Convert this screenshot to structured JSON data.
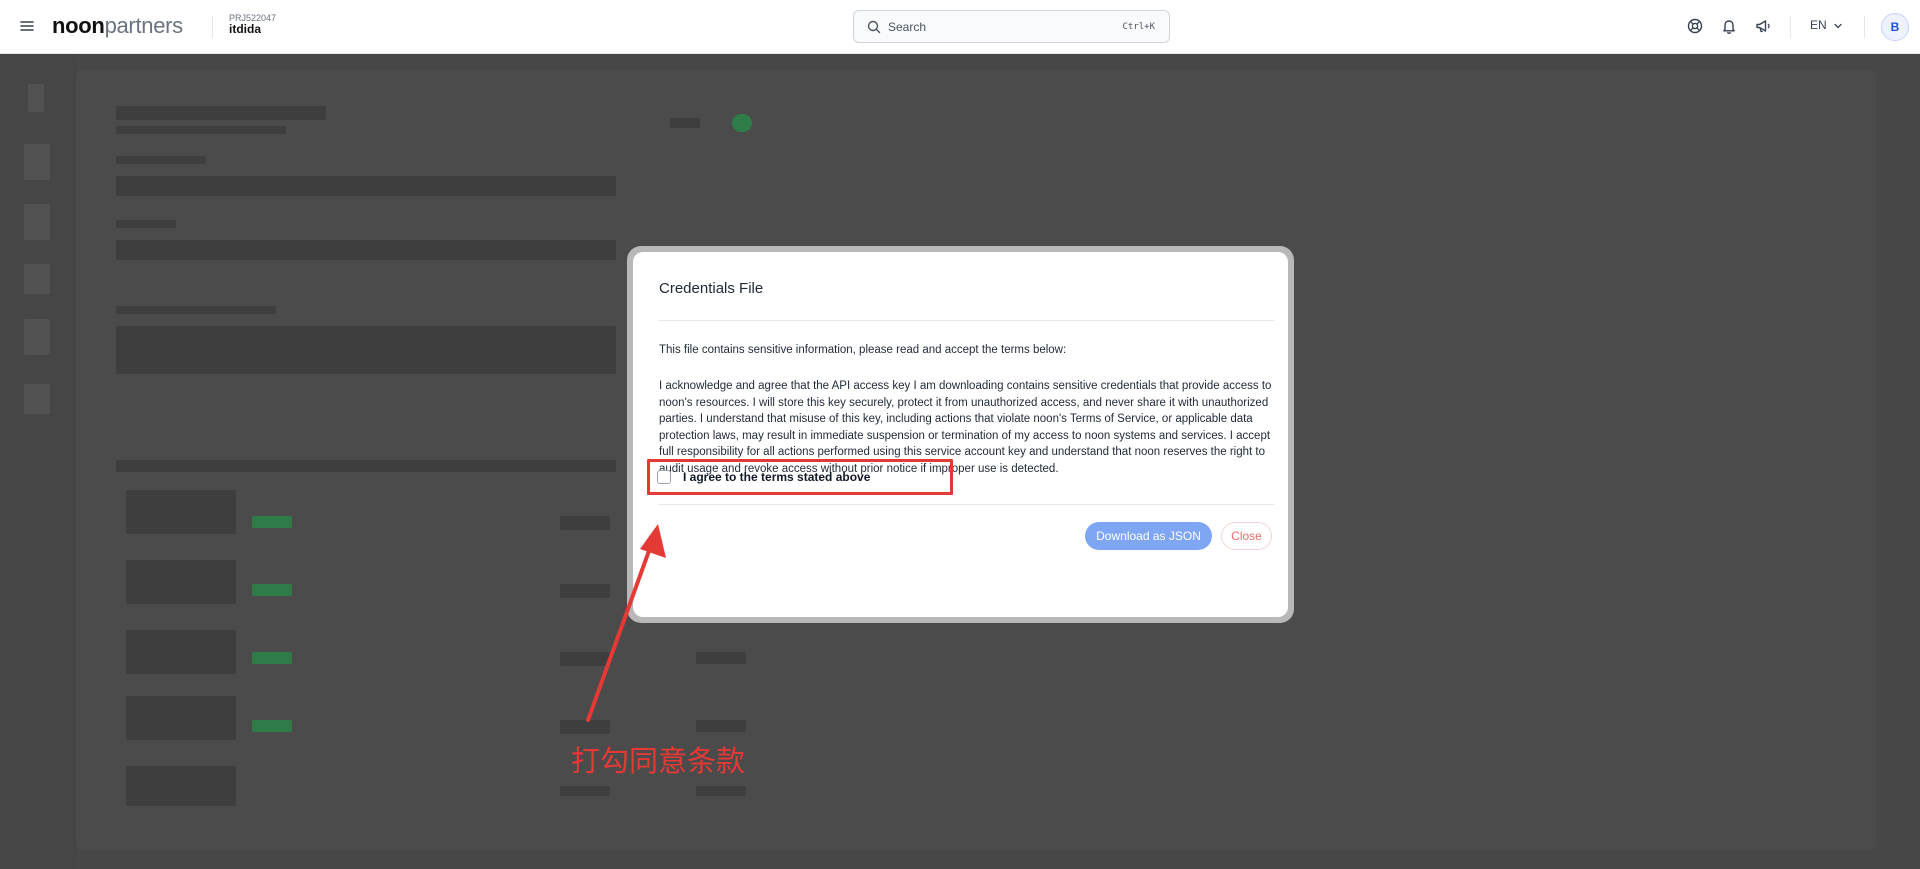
{
  "header": {
    "logo_bold": "noon",
    "logo_light": "partners",
    "project_code": "PRJ522047",
    "project_name": "itdida",
    "search_placeholder": "Search",
    "search_shortcut": "Ctrl+K",
    "language": "EN",
    "avatar_initial": "B",
    "icons": [
      "menu-icon",
      "help-icon",
      "bell-icon",
      "megaphone-icon",
      "chevron-down-icon",
      "search-icon"
    ]
  },
  "modal": {
    "title": "Credentials File",
    "intro": "This file contains sensitive information, please read and accept the terms below:",
    "terms": "I acknowledge and agree that the API access key I am downloading contains sensitive credentials that provide access to noon's resources. I will store this key securely, protect it from unauthorized access, and never share it with unauthorized parties. I understand that misuse of this key, including actions that violate noon's Terms of Service, or applicable data protection laws, may result in immediate suspension or termination of my access to noon systems and services. I accept full responsibility for all actions performed using this service account key and understand that noon reserves the right to audit usage and revoke access without prior notice if improper use is detected.",
    "agree_label": "I agree to the terms stated above",
    "agree_checked": false,
    "download_label": "Download as JSON",
    "close_label": "Close"
  },
  "annotation": {
    "text": "打勾同意条款",
    "color": "#e53935"
  },
  "colors": {
    "primary_button": "#7ea6f5",
    "close_text": "#ef6b6b",
    "annotation": "#e53935"
  }
}
